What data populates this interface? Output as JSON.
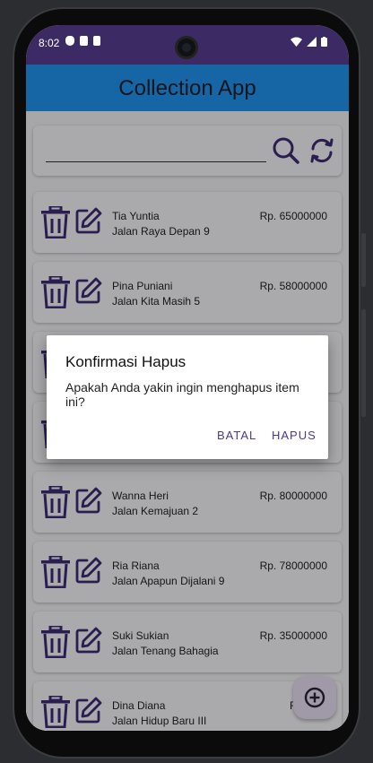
{
  "status": {
    "time": "8:02"
  },
  "app": {
    "title": "Collection App"
  },
  "search": {
    "value": ""
  },
  "items": [
    {
      "name": "Tia Yuntia",
      "address": "Jalan Raya Depan 9",
      "price": "Rp. 65000000"
    },
    {
      "name": "Pina Puniani",
      "address": "Jalan Kita Masih 5",
      "price": "Rp. 58000000"
    },
    {
      "name": "",
      "address": "",
      "price": ""
    },
    {
      "name": "",
      "address": "",
      "price": ""
    },
    {
      "name": "Wanna Heri",
      "address": "Jalan Kemajuan 2",
      "price": "Rp. 80000000"
    },
    {
      "name": "Ria Riana",
      "address": "Jalan Apapun Dijalani 9",
      "price": "Rp. 78000000"
    },
    {
      "name": "Suki Sukian",
      "address": "Jalan Tenang Bahagia",
      "price": "Rp. 35000000"
    },
    {
      "name": "Dina Diana",
      "address": "Jalan Hidup Baru III",
      "price": "Rp. 200"
    }
  ],
  "dialog": {
    "title": "Konfirmasi Hapus",
    "message": "Apakah Anda yakin ingin menghapus item ini?",
    "cancel_label": "BATAL",
    "confirm_label": "HAPUS"
  },
  "colors": {
    "appbar": "#2196f3",
    "accent": "#3f2d78",
    "statusbar": "#3b2a63"
  },
  "icons": {
    "delete": "trash-icon",
    "edit": "edit-icon",
    "search": "search-icon",
    "refresh": "refresh-icon",
    "add": "add-circle-icon"
  }
}
